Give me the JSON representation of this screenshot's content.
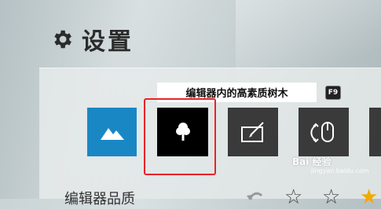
{
  "header": {
    "title": "设置",
    "icon": "gear-icon"
  },
  "tooltip": {
    "text": "编辑器内的高素质树木",
    "shortcut": "F9"
  },
  "tiles": [
    {
      "name": "landscape",
      "icon": "mountain-icon",
      "color": "#1a87c5",
      "selected": false
    },
    {
      "name": "tree",
      "icon": "tree-icon",
      "color": "#000000",
      "selected": true
    },
    {
      "name": "tablet",
      "icon": "pen-tablet-icon",
      "color": "#3a3a3a",
      "selected": false
    },
    {
      "name": "mouse",
      "icon": "mouse-icon",
      "color": "#3a3a3a",
      "selected": false
    }
  ],
  "highlight_color": "#e8242a",
  "quality_row": {
    "label": "编辑器品质",
    "stars": [
      "outline",
      "outline",
      "outline",
      "filled"
    ]
  },
  "watermark": {
    "text": "Bai 经验",
    "sub": "jingyan.baidu.com"
  }
}
